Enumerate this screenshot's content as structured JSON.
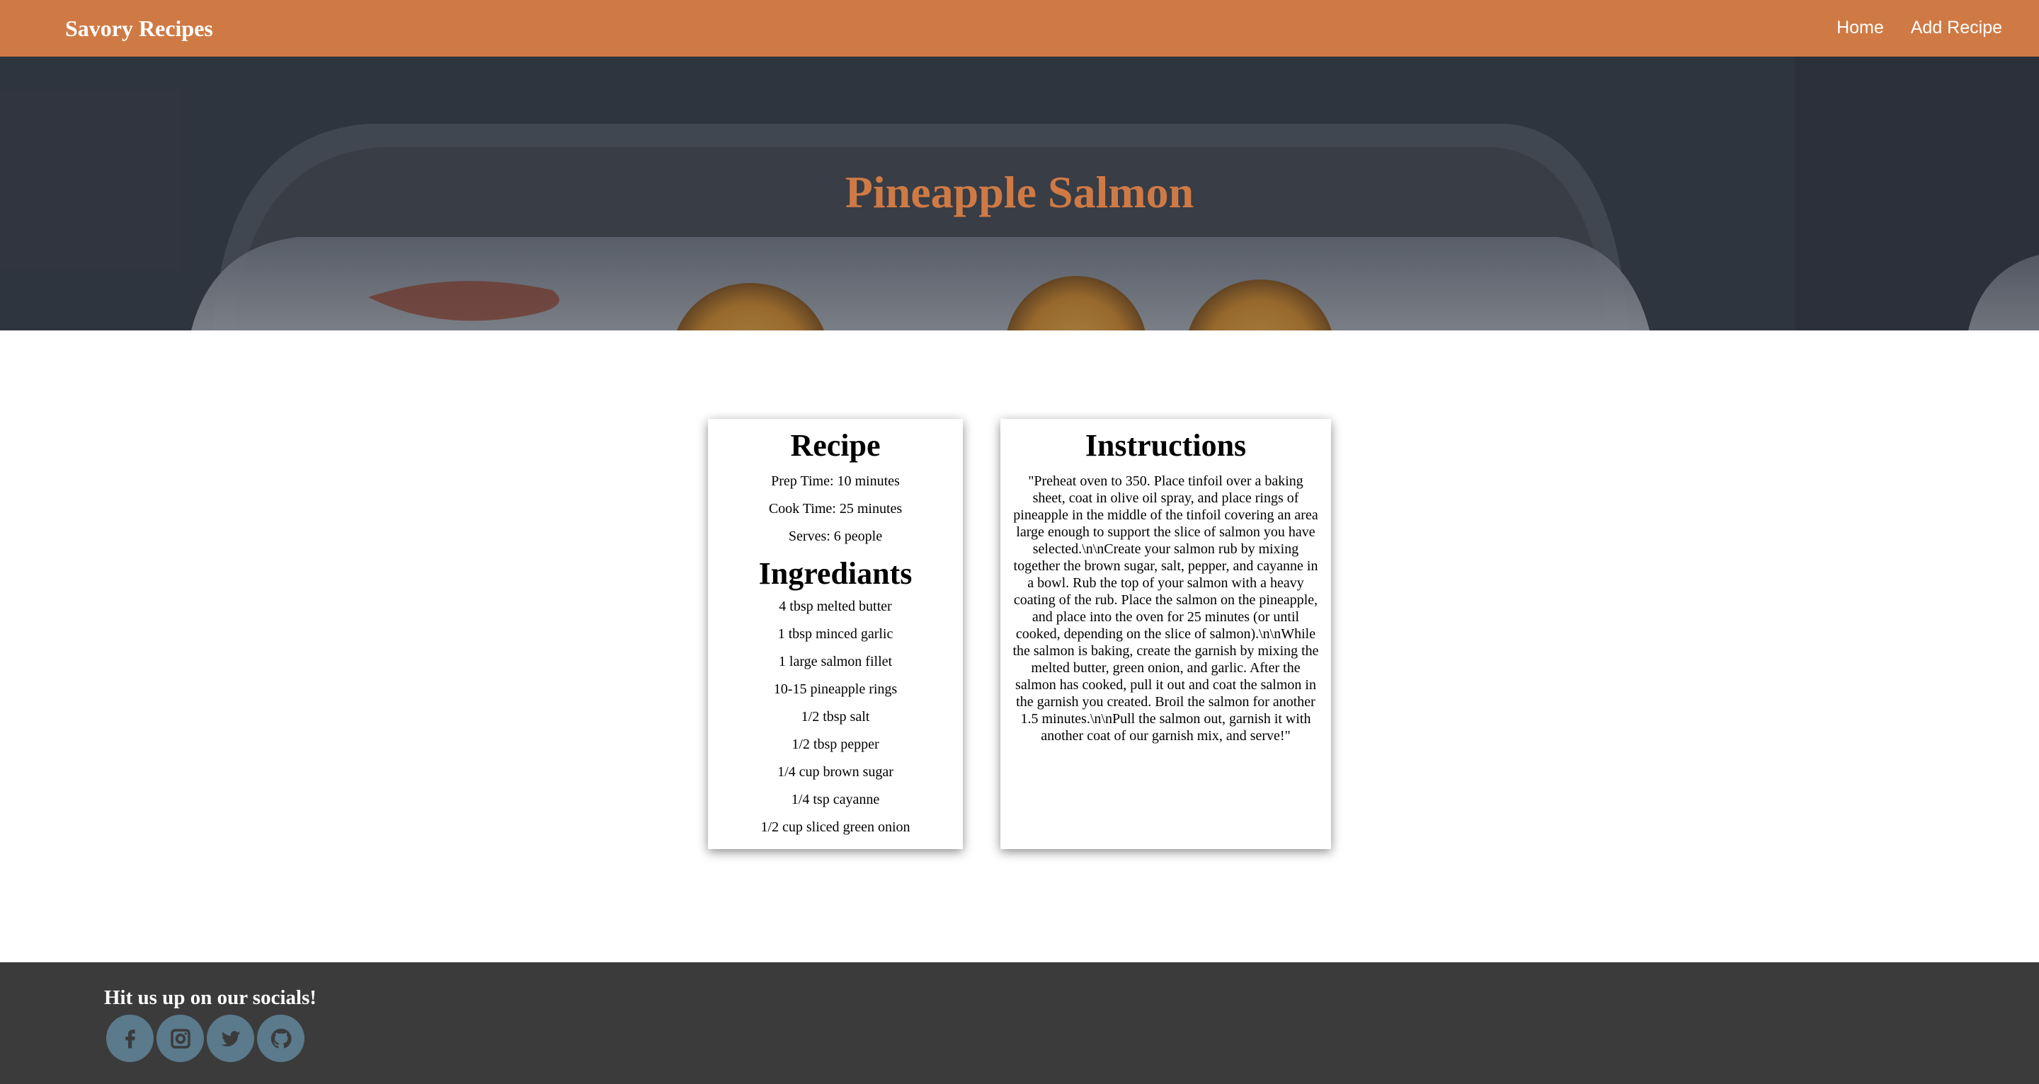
{
  "navbar": {
    "brand": "Savory Recipes",
    "links": [
      "Home",
      "Add Recipe"
    ]
  },
  "hero": {
    "title": "Pineapple Salmon"
  },
  "recipe": {
    "heading": "Recipe",
    "prep_time": "Prep Time: 10 minutes",
    "cook_time": "Cook Time: 25 minutes",
    "serves": "Serves: 6 people",
    "ingredients_heading": "Ingrediants",
    "ingredients": [
      "4 tbsp melted butter",
      "1 tbsp minced garlic",
      "1 large salmon fillet",
      "10-15 pineapple rings",
      "1/2 tbsp salt",
      "1/2 tbsp pepper",
      "1/4 cup brown sugar",
      "1/4 tsp cayanne",
      "1/2 cup sliced green onion"
    ]
  },
  "instructions": {
    "heading": "Instructions",
    "text": "\"Preheat oven to 350. Place tinfoil over a baking sheet, coat in olive oil spray, and place rings of pineapple in the middle of the tinfoil covering an area large enough to support the slice of salmon you have selected.\\n\\nCreate your salmon rub by mixing together the brown sugar, salt, pepper, and cayanne in a bowl. Rub the top of your salmon with a heavy coating of the rub. Place the salmon on the pineapple, and place into the oven for 25 minutes (or until cooked, depending on the slice of salmon).\\n\\nWhile the salmon is baking, create the garnish by mixing the melted butter, green onion, and garlic. After the salmon has cooked, pull it out and coat the salmon in the garnish you created. Broil the salmon for another 1.5 minutes.\\n\\nPull the salmon out, garnish it with another coat of our garnish mix, and serve!\""
  },
  "footer": {
    "text": "Hit us up on our socials!",
    "socials": [
      "facebook-icon",
      "instagram-icon",
      "twitter-icon",
      "github-icon"
    ]
  },
  "colors": {
    "accent": "#cf7a45",
    "footer_bg": "#3b3b3b",
    "social_bg": "#5b7a8c"
  }
}
